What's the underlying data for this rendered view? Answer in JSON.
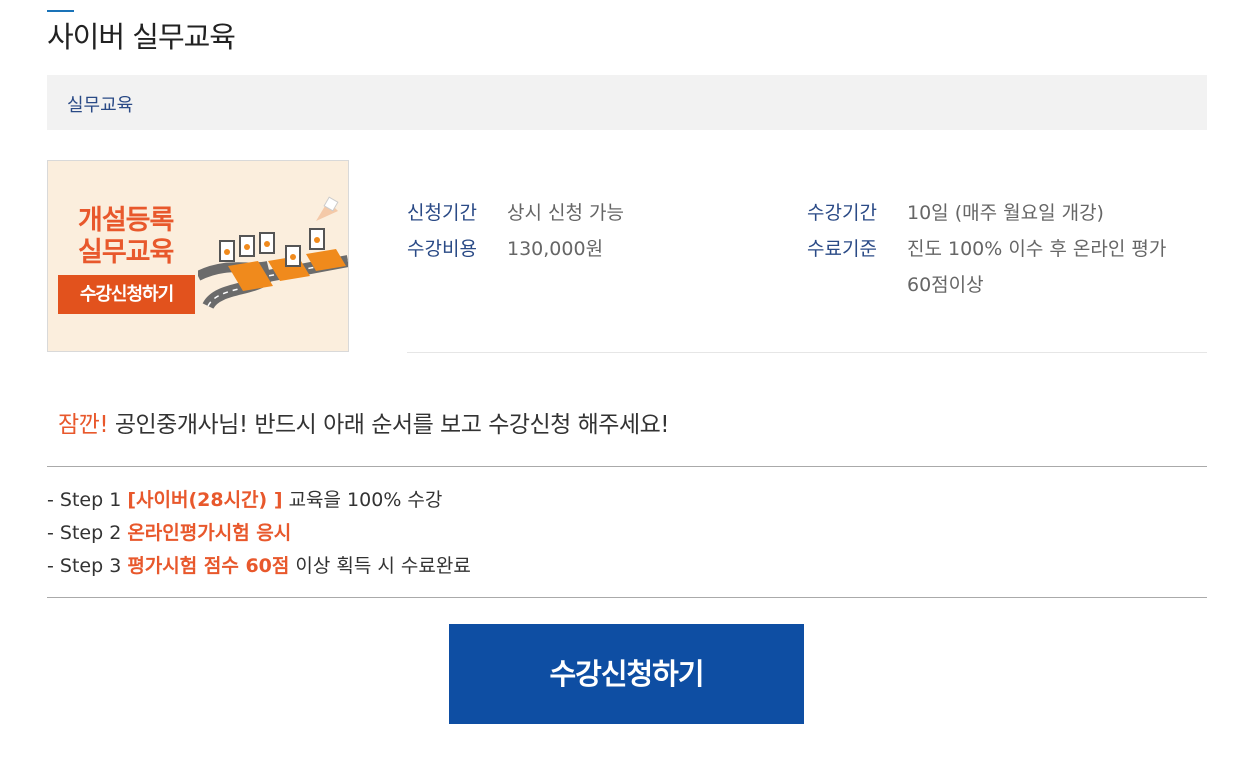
{
  "page": {
    "title": "사이버 실무교육",
    "breadcrumb": "실무교육"
  },
  "banner": {
    "line1": "개설등록",
    "line2": "실무교육",
    "button": "수강신청하기"
  },
  "info": {
    "apply_period_label": "신청기간",
    "apply_period_value": "상시 신청 가능",
    "fee_label": "수강비용",
    "fee_value": "130,000원",
    "course_period_label": "수강기간",
    "course_period_value": "10일 (매주 월요일 개강)",
    "completion_label": "수료기준",
    "completion_value_line1": "진도 100% 이수 후 온라인 평가",
    "completion_value_line2": "60점이상"
  },
  "notice": {
    "wait": "잠깐!",
    "text": " 공인중개사님! 반드시 아래 순서를 보고 수강신청 해주세요!"
  },
  "steps": [
    {
      "prefix": "- Step 1 ",
      "highlight": "[사이버(28시간) ]",
      "suffix": " 교육을 100% 수강"
    },
    {
      "prefix": "- Step 2 ",
      "highlight": "온라인평가시험 응시",
      "suffix": ""
    },
    {
      "prefix": "- Step 3 ",
      "highlight": "평가시험 점수 60점",
      "suffix": " 이상 획득 시 수료완료"
    }
  ],
  "cta": {
    "label": "수강신청하기"
  },
  "colors": {
    "accent": "#e8582c",
    "primary": "#0e4ea3",
    "label": "#2a4a86"
  }
}
